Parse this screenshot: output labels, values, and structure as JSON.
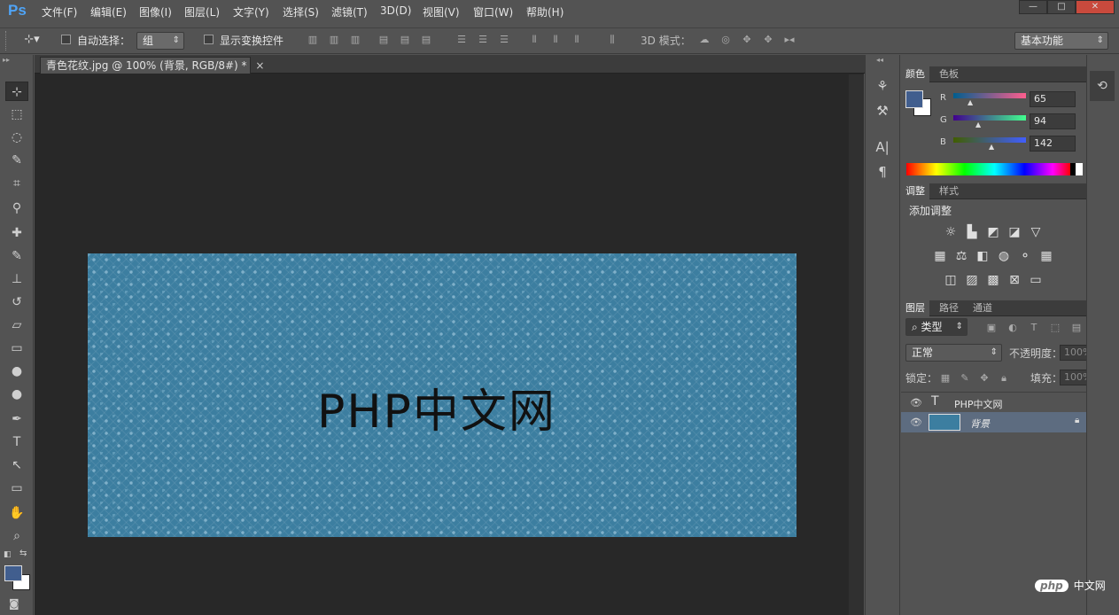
{
  "app": {
    "logo": "Ps"
  },
  "menu": [
    "文件(F)",
    "编辑(E)",
    "图像(I)",
    "图层(L)",
    "文字(Y)",
    "选择(S)",
    "滤镜(T)",
    "3D(D)",
    "视图(V)",
    "窗口(W)",
    "帮助(H)"
  ],
  "window_controls": {
    "minimize": "—",
    "maximize": "□",
    "close": "✕"
  },
  "options": {
    "auto_select_label": "自动选择：",
    "auto_select_value": "组",
    "show_transform_label": "显示变换控件",
    "mode3d_label": "3D 模式：",
    "workspace": "基本功能"
  },
  "document": {
    "tab_title": "青色花纹.jpg @ 100% (背景, RGB/8#) *",
    "tab_close": "×",
    "canvas_text": "PHP中文网",
    "canvas_color": "#3c7ea0"
  },
  "tools": [
    {
      "name": "move-tool",
      "glyph": "⊹"
    },
    {
      "name": "marquee-tool",
      "glyph": "⬚"
    },
    {
      "name": "lasso-tool",
      "glyph": "◌"
    },
    {
      "name": "quick-select-tool",
      "glyph": "✎"
    },
    {
      "name": "crop-tool",
      "glyph": "⌗"
    },
    {
      "name": "eyedropper-tool",
      "glyph": "⚲"
    },
    {
      "name": "healing-tool",
      "glyph": "✚"
    },
    {
      "name": "brush-tool",
      "glyph": "✎"
    },
    {
      "name": "stamp-tool",
      "glyph": "⊥"
    },
    {
      "name": "history-brush-tool",
      "glyph": "↺"
    },
    {
      "name": "eraser-tool",
      "glyph": "▱"
    },
    {
      "name": "gradient-tool",
      "glyph": "▭"
    },
    {
      "name": "blur-tool",
      "glyph": "●"
    },
    {
      "name": "dodge-tool",
      "glyph": "●"
    },
    {
      "name": "pen-tool",
      "glyph": "✒"
    },
    {
      "name": "type-tool",
      "glyph": "T"
    },
    {
      "name": "path-select-tool",
      "glyph": "↖"
    },
    {
      "name": "shape-tool",
      "glyph": "▭"
    },
    {
      "name": "hand-tool",
      "glyph": "✋"
    },
    {
      "name": "zoom-tool",
      "glyph": "⌕"
    }
  ],
  "colors": {
    "foreground": "#415e8e",
    "background": "#ffffff"
  },
  "color_panel": {
    "tabs": [
      "颜色",
      "色板"
    ],
    "r_label": "R",
    "g_label": "G",
    "b_label": "B",
    "r": "65",
    "g": "94",
    "b": "142"
  },
  "adjust_panel": {
    "tabs": [
      "调整",
      "样式"
    ],
    "title": "添加调整"
  },
  "layers_panel": {
    "tabs": [
      "图层",
      "路径",
      "通道"
    ],
    "filter": "类型",
    "blend": "正常",
    "opacity_label": "不透明度：",
    "opacity": "100%",
    "lock_label": "锁定：",
    "fill_label": "填充：",
    "fill": "100%",
    "layers": [
      {
        "name": "PHP中文网",
        "kind": "T"
      },
      {
        "name": "背景",
        "kind": "image"
      }
    ]
  },
  "watermark": {
    "logo": "php",
    "text": "中文网"
  }
}
